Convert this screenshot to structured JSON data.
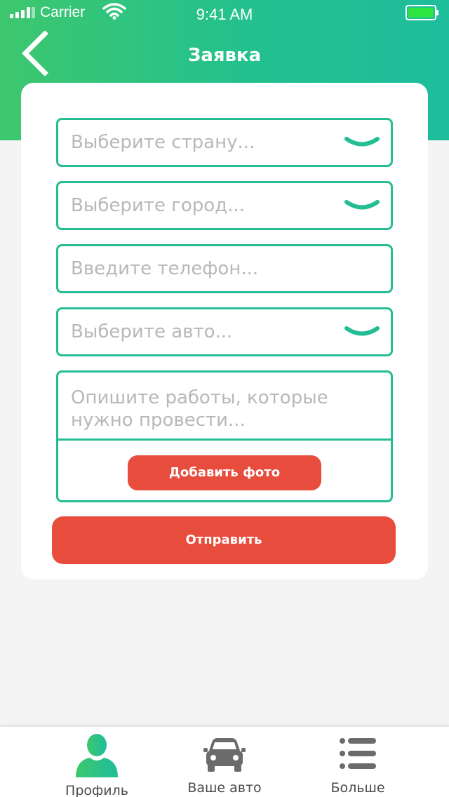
{
  "status_bar": {
    "carrier": "Carrier",
    "time": "9:41 AM",
    "icons": [
      "signal-bars-icon",
      "wifi-icon",
      "battery-icon"
    ]
  },
  "header": {
    "title": "Заявка",
    "back_icon": "chevron-left-icon"
  },
  "form": {
    "country_placeholder": "Выберите страну...",
    "city_placeholder": "Выберите город...",
    "phone_placeholder": "Введите телефон...",
    "car_placeholder": "Выберите авто...",
    "description_placeholder": "Опишите работы, которые нужно провести...",
    "add_photo_label": "Добавить фото",
    "submit_label": "Отправить"
  },
  "tabbar": {
    "items": [
      {
        "label": "Профиль",
        "icon": "user-icon",
        "active": true
      },
      {
        "label": "Ваше авто",
        "icon": "car-icon",
        "active": false
      },
      {
        "label": "Больше",
        "icon": "list-menu-icon",
        "active": false
      }
    ]
  },
  "colors": {
    "accent_green": "#25bd94",
    "header_gradient_start": "#3dc76e",
    "header_gradient_end": "#1ebd9c",
    "button_red": "#e84c3d",
    "battery_fill": "#2ee53f"
  }
}
